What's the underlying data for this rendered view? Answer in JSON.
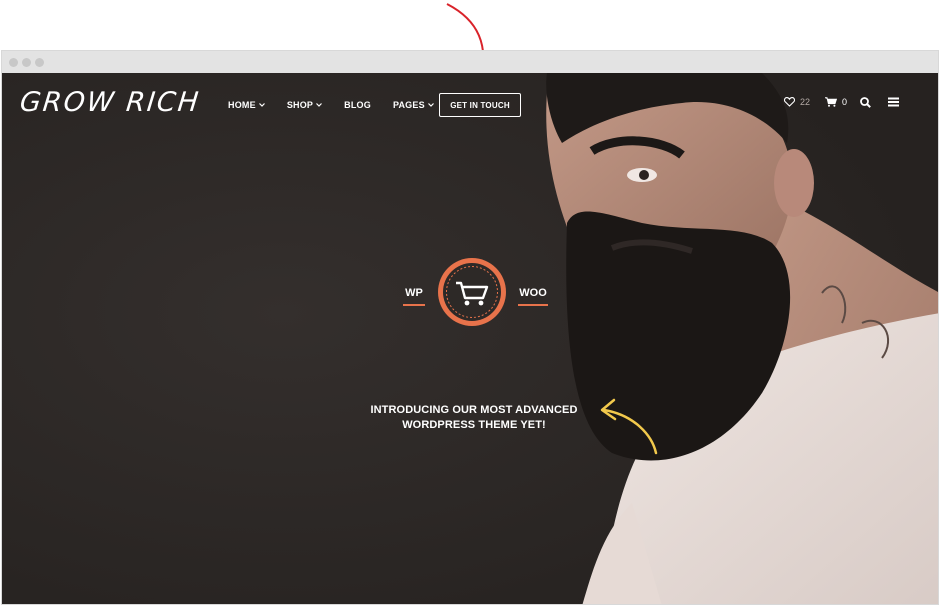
{
  "header": {
    "logo": "GROW RICH",
    "nav": [
      {
        "label": "HOME",
        "has_caret": true
      },
      {
        "label": "SHOP",
        "has_caret": true
      },
      {
        "label": "BLOG",
        "has_caret": false
      },
      {
        "label": "PAGES",
        "has_caret": true
      }
    ],
    "cta_label": "GET IN TOUCH",
    "wishlist_count": "22",
    "cart_count": "0",
    "icons": [
      "heart-icon",
      "cart-icon",
      "search-icon",
      "menu-icon"
    ]
  },
  "hero": {
    "left_label": "WP",
    "right_label": "WOO",
    "badge_icon": "shopping-cart-icon",
    "tagline_line1": "INTRODUCING OUR MOST ADVANCED",
    "tagline_line2": "WORDPRESS THEME YET!"
  },
  "colors": {
    "accent": "#e8734b",
    "background": "#2d2927",
    "annotation_red": "#d9232a",
    "annotation_yellow": "#f2c94c"
  }
}
